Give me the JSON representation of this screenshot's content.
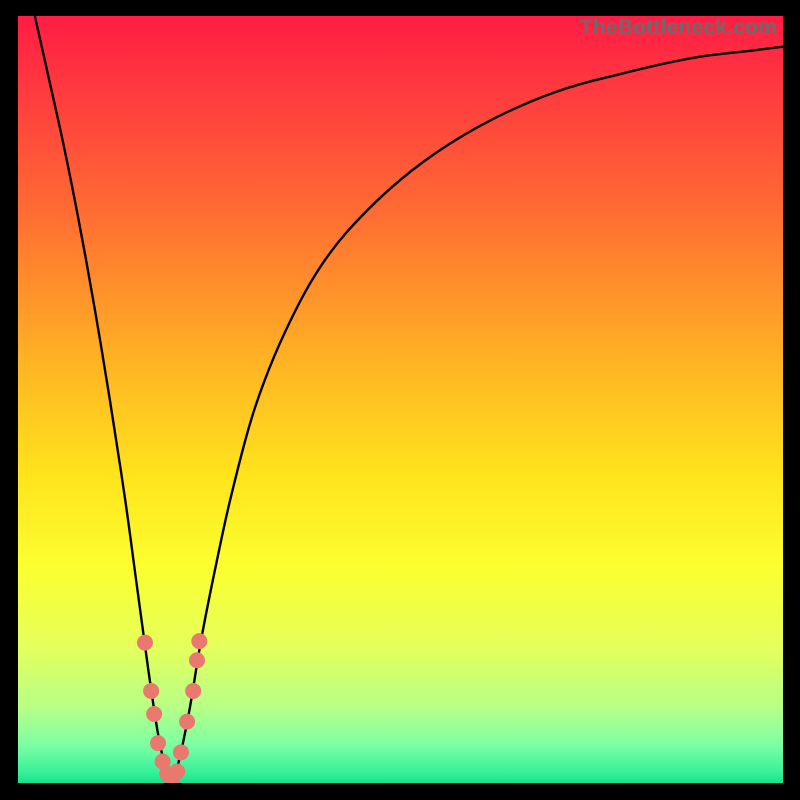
{
  "watermark": "TheBottleneck.com",
  "chart_data": {
    "type": "line",
    "title": "",
    "xlabel": "",
    "ylabel": "",
    "xlim": [
      0,
      100
    ],
    "ylim": [
      0,
      100
    ],
    "background_gradient": {
      "type": "vertical",
      "stops": [
        {
          "pos": 0.0,
          "color": "#ff1d44"
        },
        {
          "pos": 0.1,
          "color": "#ff3b3f"
        },
        {
          "pos": 0.25,
          "color": "#ff6a33"
        },
        {
          "pos": 0.45,
          "color": "#ffb324"
        },
        {
          "pos": 0.6,
          "color": "#ffe41c"
        },
        {
          "pos": 0.72,
          "color": "#fbff30"
        },
        {
          "pos": 0.82,
          "color": "#e6ff5a"
        },
        {
          "pos": 0.9,
          "color": "#b8ff86"
        },
        {
          "pos": 0.95,
          "color": "#7dffa3"
        },
        {
          "pos": 0.985,
          "color": "#38f29a"
        },
        {
          "pos": 1.0,
          "color": "#17e38a"
        }
      ]
    },
    "series": [
      {
        "name": "bottleneck-curve",
        "color": "#000000",
        "x": [
          2.2,
          4.0,
          6.0,
          8.0,
          10.0,
          12.0,
          14.0,
          15.5,
          17.0,
          18.2,
          19.0,
          19.5,
          20.0,
          20.5,
          21.3,
          22.5,
          24.0,
          26.0,
          28.0,
          31.0,
          35.0,
          40.0,
          46.0,
          53.0,
          61.0,
          70.0,
          79.0,
          88.0,
          96.0,
          100.0
        ],
        "y": [
          100,
          92,
          83,
          73,
          62,
          50,
          37,
          26,
          15,
          7,
          3,
          1,
          0,
          1,
          4,
          10,
          19,
          29,
          38,
          49,
          59,
          68,
          75,
          81,
          86,
          90,
          92.5,
          94.5,
          95.5,
          96
        ]
      }
    ],
    "markers": {
      "name": "highlight-points",
      "color": "#e9786f",
      "radius": 8,
      "points": [
        {
          "x": 16.6,
          "y": 18.3
        },
        {
          "x": 17.4,
          "y": 12.0
        },
        {
          "x": 17.8,
          "y": 9.0
        },
        {
          "x": 18.3,
          "y": 5.2
        },
        {
          "x": 18.9,
          "y": 2.8
        },
        {
          "x": 19.5,
          "y": 1.2
        },
        {
          "x": 20.1,
          "y": 0.5
        },
        {
          "x": 20.8,
          "y": 1.5
        },
        {
          "x": 21.3,
          "y": 4.0
        },
        {
          "x": 22.1,
          "y": 8.0
        },
        {
          "x": 22.9,
          "y": 12.0
        },
        {
          "x": 23.4,
          "y": 16.0
        },
        {
          "x": 23.7,
          "y": 18.5
        }
      ]
    }
  }
}
